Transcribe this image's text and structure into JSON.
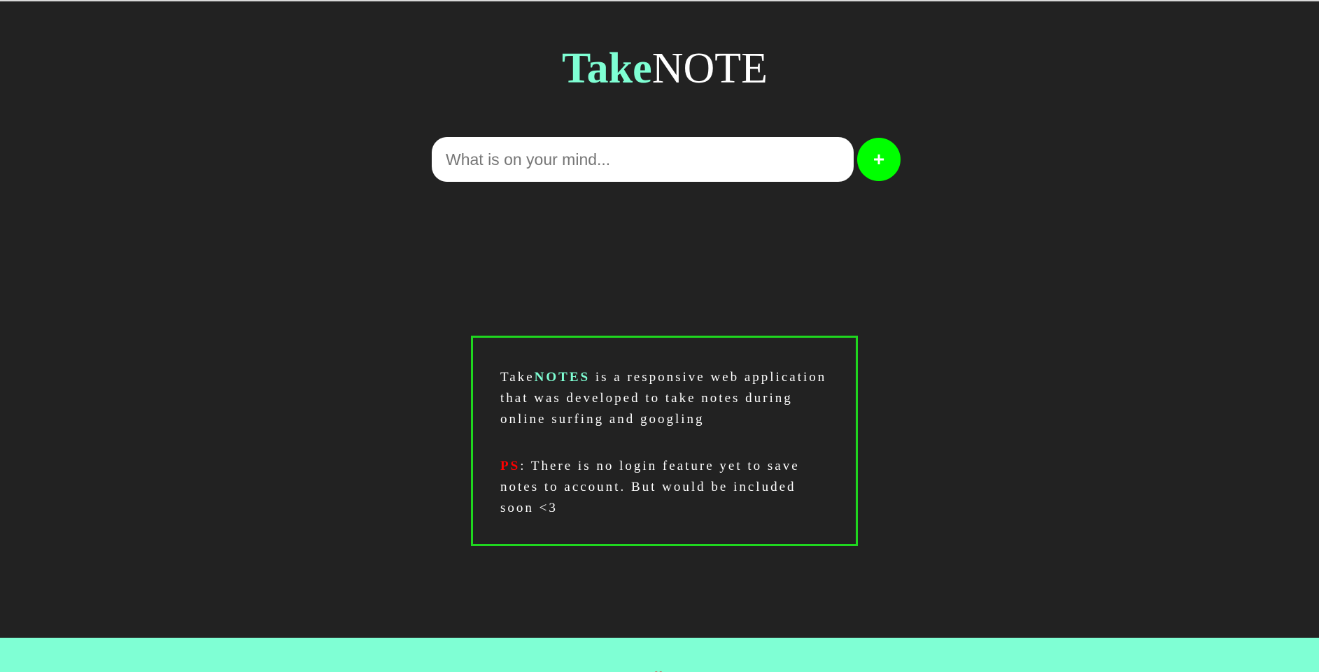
{
  "header": {
    "title_take": "Take",
    "title_note": "NOTE"
  },
  "input": {
    "placeholder": "What is on your mind...",
    "value": ""
  },
  "add_button": {
    "label": "+"
  },
  "info": {
    "para1_take": "Take",
    "para1_notes": "NOTES",
    "para1_rest": " is a responsive web application that was developed to take notes during online surfing and googling",
    "ps_label": "PS",
    "ps_rest": ": There is no login feature yet to save notes to account. But would be included soon <3"
  },
  "footer": {
    "heart": "❤"
  },
  "colors": {
    "background": "#222222",
    "accent": "#7fffd4",
    "add_button": "#00ff00",
    "box_border": "#1fd71f",
    "ps": "#ff0000"
  }
}
